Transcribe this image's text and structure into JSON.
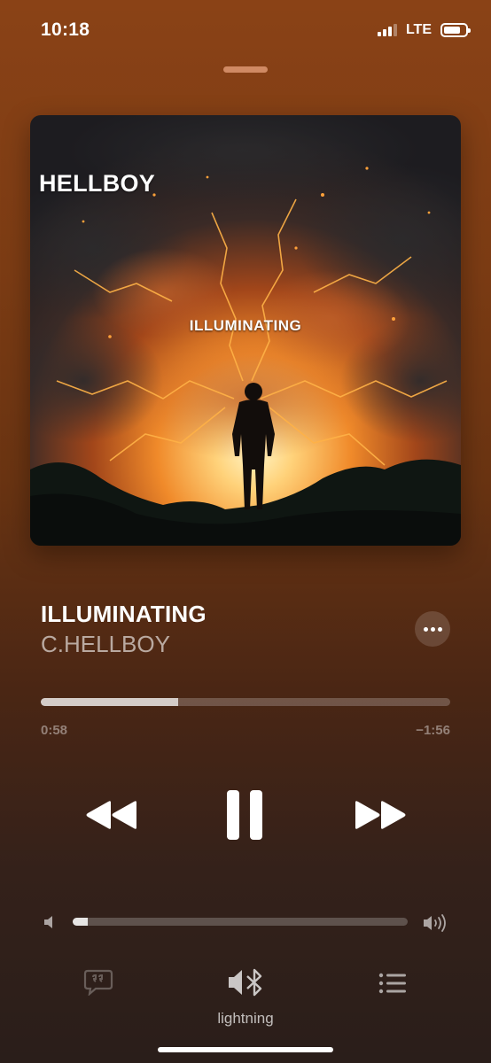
{
  "status_bar": {
    "time": "10:18",
    "network": "LTE",
    "signal_bars_active": 3,
    "battery_level": 0.78
  },
  "artwork": {
    "artist_text": "HELLBOY",
    "title_text": "ILLUMINATING"
  },
  "track": {
    "title": "ILLUMINATING",
    "artist": "C.HELLBOY"
  },
  "playback": {
    "elapsed": "0:58",
    "remaining": "−1:56",
    "progress_fraction": 0.335,
    "state": "playing"
  },
  "volume": {
    "level_fraction": 0.045
  },
  "output": {
    "device_name": "lightning"
  },
  "icons": {
    "more": "ellipsis-icon",
    "rewind": "rewind-icon",
    "pause": "pause-icon",
    "forward": "fast-forward-icon",
    "volume_low": "speaker-low-icon",
    "volume_high": "speaker-high-icon",
    "lyrics": "lyrics-bubble-icon",
    "airplay": "speaker-bluetooth-icon",
    "queue": "list-icon"
  },
  "colors": {
    "accent_background_top": "#8a4216",
    "accent_background_bottom": "#2a1e1a"
  }
}
